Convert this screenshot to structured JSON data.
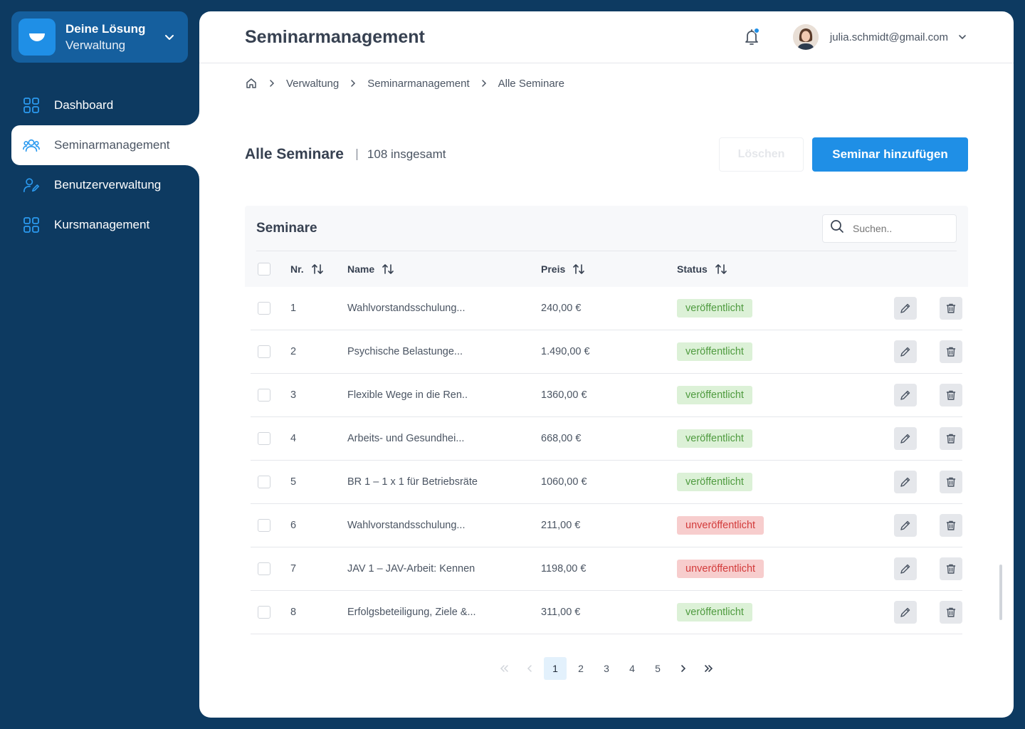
{
  "brand": {
    "title": "Deine Lösung",
    "subtitle": "Verwaltung"
  },
  "nav": [
    {
      "label": "Dashboard",
      "icon": "grid-icon",
      "active": false
    },
    {
      "label": "Seminarmanagement",
      "icon": "users-icon",
      "active": true
    },
    {
      "label": "Benutzerverwaltung",
      "icon": "user-edit-icon",
      "active": false
    },
    {
      "label": "Kursmanagement",
      "icon": "grid-icon",
      "active": false
    }
  ],
  "header": {
    "title": "Seminarmanagement",
    "user_email": "julia.schmidt@gmail.com"
  },
  "breadcrumb": [
    "Verwaltung",
    "Seminarmanagement",
    "Alle Seminare"
  ],
  "section": {
    "title": "Alle Seminare",
    "count": "108 insgesamt",
    "delete_label": "Löschen",
    "add_label": "Seminar hinzufügen"
  },
  "table": {
    "title": "Seminare",
    "search_placeholder": "Suchen..",
    "columns": [
      "Nr.",
      "Name",
      "Preis",
      "Status"
    ],
    "rows": [
      {
        "nr": "1",
        "name": "Wahlvorstandsschulung...",
        "preis": "240,00 €",
        "status": "veröffentlicht",
        "published": true
      },
      {
        "nr": "2",
        "name": "Psychische Belastunge...",
        "preis": "1.490,00 €",
        "status": "veröffentlicht",
        "published": true
      },
      {
        "nr": "3",
        "name": "Flexible Wege in die Ren..",
        "preis": "1360,00 €",
        "status": "veröffentlicht",
        "published": true
      },
      {
        "nr": "4",
        "name": "Arbeits- und Gesundhei...",
        "preis": "668,00 €",
        "status": "veröffentlicht",
        "published": true
      },
      {
        "nr": "5",
        "name": "BR 1 – 1 x 1 für Betriebsräte",
        "preis": "1060,00 €",
        "status": "veröffentlicht",
        "published": true
      },
      {
        "nr": "6",
        "name": "Wahlvorstandsschulung...",
        "preis": "211,00 €",
        "status": "unveröffentlicht",
        "published": false
      },
      {
        "nr": "7",
        "name": "JAV 1 – JAV-Arbeit: Kennen",
        "preis": "1198,00 €",
        "status": "unveröffentlicht",
        "published": false
      },
      {
        "nr": "8",
        "name": "Erfolgsbeteiligung, Ziele &...",
        "preis": "311,00 €",
        "status": "veröffentlicht",
        "published": true
      }
    ]
  },
  "pagination": {
    "pages": [
      "1",
      "2",
      "3",
      "4",
      "5"
    ],
    "current": "1"
  },
  "colors": {
    "navy": "#0d3a61",
    "accent": "#1f8fe6",
    "published_bg": "#dcf1d7",
    "published_fg": "#4f9b3f",
    "unpublished_bg": "#f7cdcd",
    "unpublished_fg": "#d33b3b"
  }
}
